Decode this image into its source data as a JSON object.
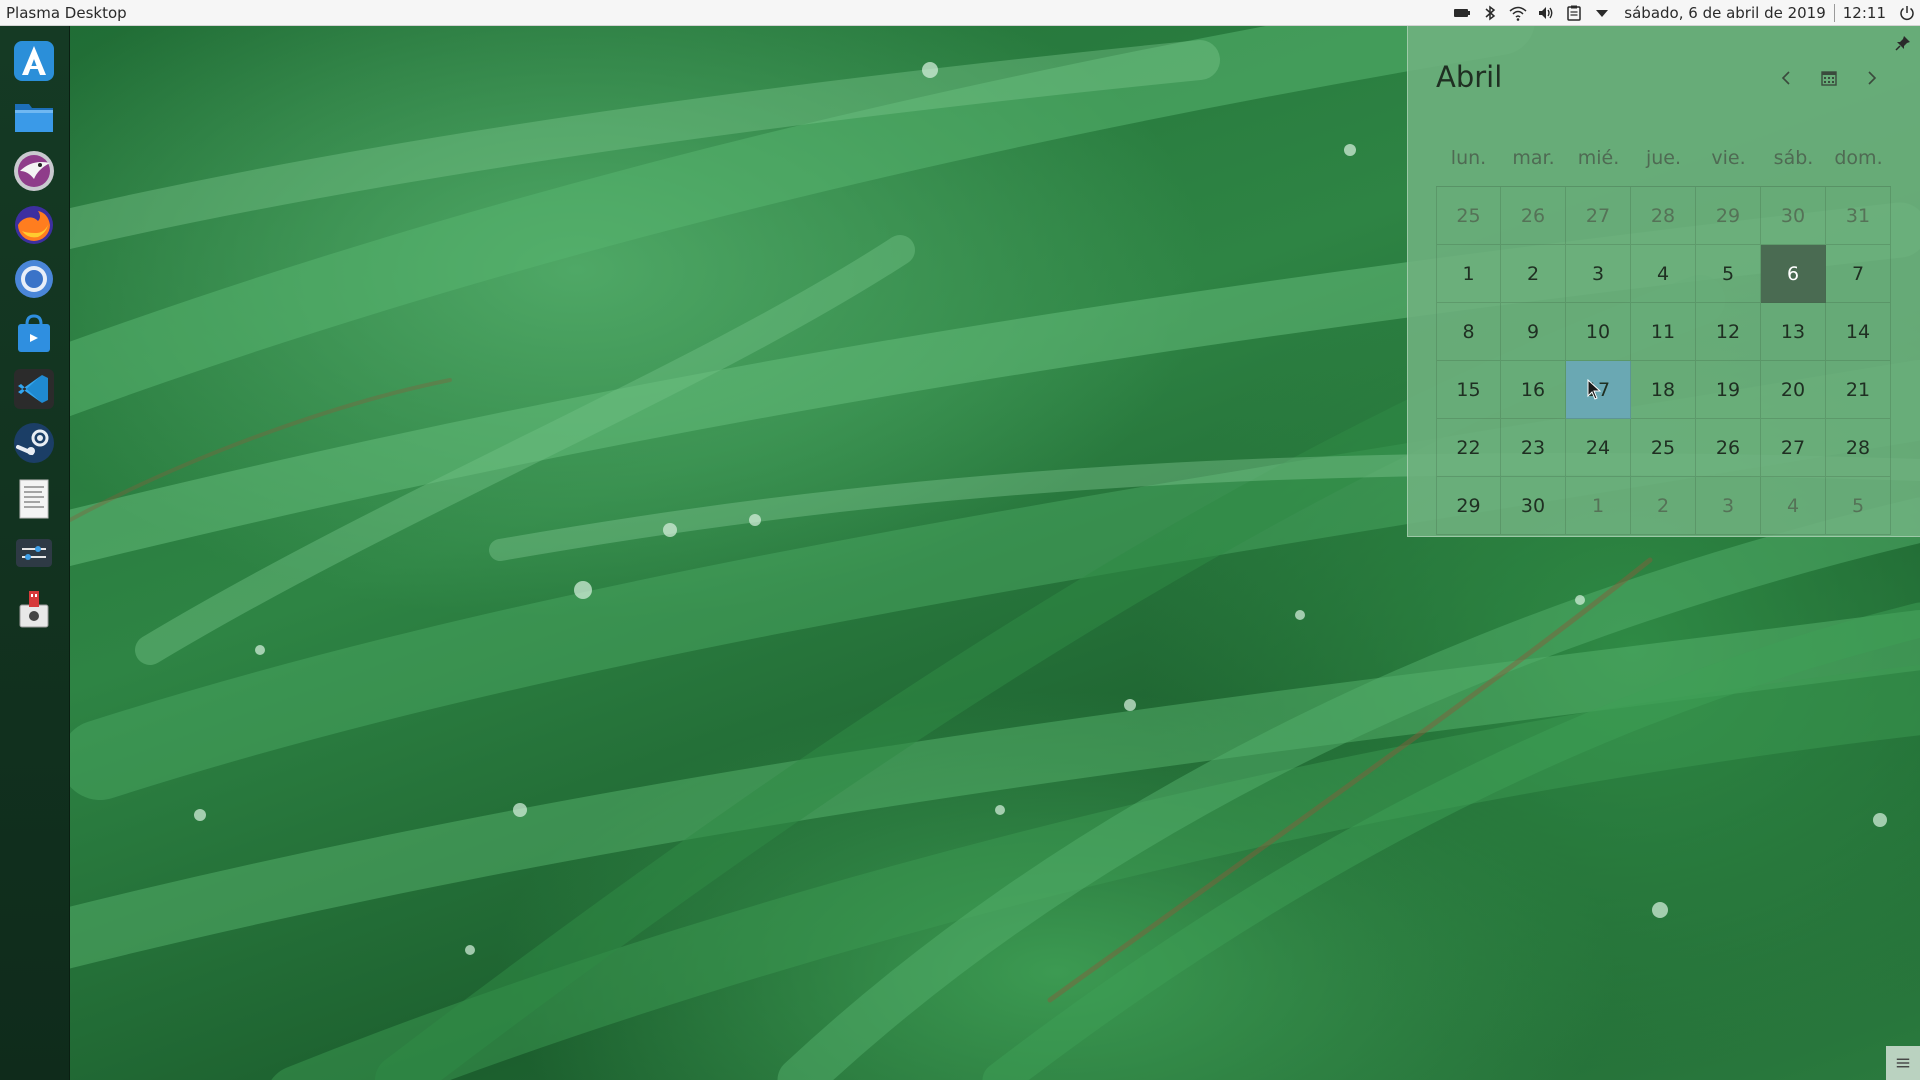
{
  "panel": {
    "app_title": "Plasma Desktop",
    "date": "sábado, 6 de abril de 2019",
    "time": "12:11"
  },
  "tray_icons": [
    "battery-icon",
    "bluetooth-icon",
    "wifi-icon",
    "volume-icon",
    "clipboard-icon",
    "tray-expand-icon"
  ],
  "dock": [
    "kde-discover-icon",
    "file-manager-icon",
    "eagle-browser-icon",
    "firefox-icon",
    "chromium-icon",
    "software-store-icon",
    "vscode-icon",
    "steam-icon",
    "text-editor-icon",
    "system-settings-icon",
    "usb-writer-icon"
  ],
  "calendar": {
    "month": "Abril",
    "weekdays": [
      "lun.",
      "mar.",
      "mié.",
      "jue.",
      "vie.",
      "sáb.",
      "dom."
    ],
    "weeks": [
      [
        "25",
        "26",
        "27",
        "28",
        "29",
        "30",
        "31"
      ],
      [
        "1",
        "2",
        "3",
        "4",
        "5",
        "6",
        "7"
      ],
      [
        "8",
        "9",
        "10",
        "11",
        "12",
        "13",
        "14"
      ],
      [
        "15",
        "16",
        "17",
        "18",
        "19",
        "20",
        "21"
      ],
      [
        "22",
        "23",
        "24",
        "25",
        "26",
        "27",
        "28"
      ],
      [
        "29",
        "30",
        "1",
        "2",
        "3",
        "4",
        "5"
      ]
    ],
    "today": "6",
    "hovered": "17"
  },
  "colors": {
    "today_bg": "#4a6b52",
    "hover_bg": "#6aa8b3",
    "popup_bg": "#70b280"
  }
}
